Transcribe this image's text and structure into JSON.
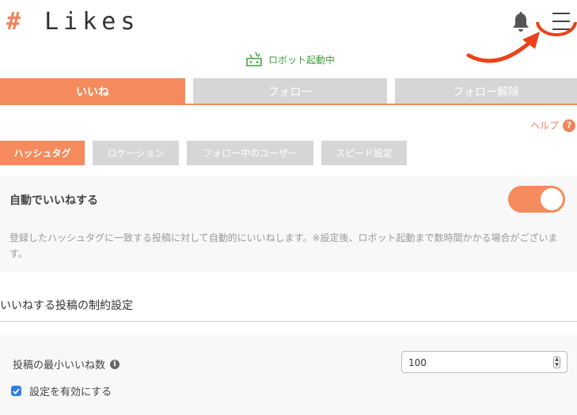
{
  "header": {
    "logo_hash": "#",
    "logo_text": "Likes",
    "notification_icon": "bell-icon",
    "menu_icon": "hamburger-menu-icon",
    "annotation_color": "#e8431a"
  },
  "status": {
    "robot_text": "ロボット起動中",
    "robot_icon": "robot-icon",
    "color": "#3aa03a"
  },
  "main_tabs": [
    {
      "label": "いいね",
      "active": true
    },
    {
      "label": "フォロー",
      "active": false
    },
    {
      "label": "フォロー解除",
      "active": false
    }
  ],
  "help": {
    "label": "ヘルプ",
    "icon_text": "?"
  },
  "sub_tabs": [
    {
      "label": "ハッシュタグ",
      "active": true
    },
    {
      "label": "ロケーション",
      "active": false
    },
    {
      "label": "フォロー中のユーザー",
      "active": false
    },
    {
      "label": "スピード設定",
      "active": false
    }
  ],
  "auto_like": {
    "title": "自動でいいねする",
    "enabled": true,
    "description": "登録したハッシュタグに一致する投稿に対して自動的にいいねします。※設定後、ロボット起動まで数時間かかる場合がございます。"
  },
  "constraints": {
    "section_title": "いいねする投稿の制約設定",
    "min_likes_label": "投稿の最小いいね数",
    "info_icon_text": "i",
    "min_likes_value": "100",
    "enable_label": "設定を有効にする",
    "enable_checked": true
  },
  "colors": {
    "accent": "#f58a5c",
    "inactive_tab": "#d6d6d6",
    "checkbox": "#2f7fe8"
  }
}
